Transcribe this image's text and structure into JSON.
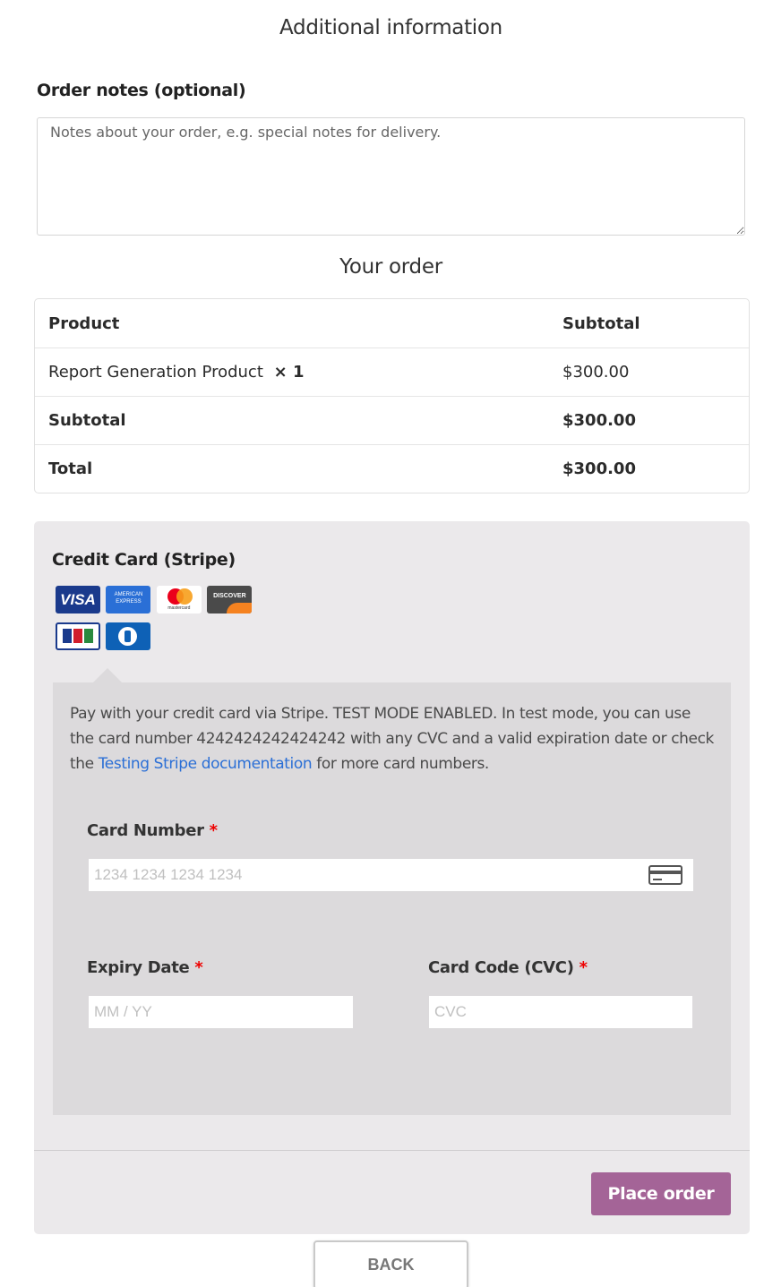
{
  "additional": {
    "title": "Additional information",
    "notes_label": "Order notes (optional)",
    "notes_placeholder": "Notes about your order, e.g. special notes for delivery."
  },
  "order": {
    "title": "Your order",
    "header": {
      "product": "Product",
      "subtotal": "Subtotal"
    },
    "items": [
      {
        "name": "Report Generation Product",
        "qty": "× 1",
        "price": "$300.00"
      }
    ],
    "subtotal_label": "Subtotal",
    "subtotal_value": "$300.00",
    "total_label": "Total",
    "total_value": "$300.00"
  },
  "payment": {
    "method_label": "Credit Card (Stripe)",
    "card_brands": [
      "visa-icon",
      "amex-icon",
      "mastercard-icon",
      "discover-icon",
      "jcb-icon",
      "diners-club-icon"
    ],
    "brand_text": {
      "visa": "VISA",
      "amex": "AMERICAN EXPRESS",
      "mastercard": "mastercard",
      "discover": "DISCOVER",
      "jcb": "JCB"
    },
    "description_before": "Pay with your credit card via Stripe. TEST MODE ENABLED. In test mode, you can use the card number 4242424242424242 with any CVC and a valid expiration date or check the ",
    "description_link": "Testing Stripe documentation",
    "description_after": " for more card numbers.",
    "card_number_label": "Card Number",
    "card_number_placeholder": "1234 1234 1234 1234",
    "expiry_label": "Expiry Date",
    "expiry_placeholder": "MM / YY",
    "cvc_label": "Card Code (CVC)",
    "cvc_placeholder": "CVC",
    "required_mark": "*",
    "place_order": "Place order"
  },
  "back_button": "BACK",
  "colors": {
    "accent": "#a46497",
    "link": "#2b6fd6",
    "panel": "#ebe9eb",
    "required": "#e00000"
  }
}
